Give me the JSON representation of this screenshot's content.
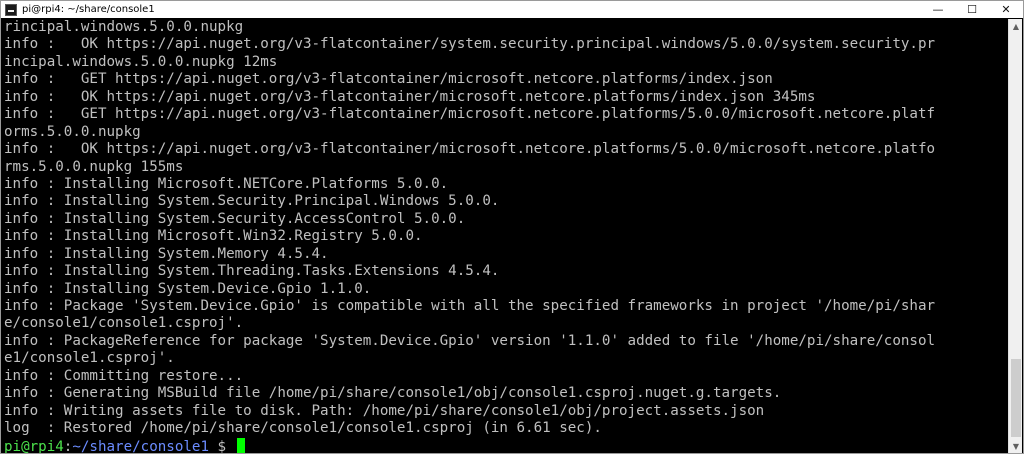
{
  "window": {
    "title": "pi@rpi4: ~/share/console1",
    "minimize": "—",
    "maximize": "☐",
    "close": "✕"
  },
  "terminal": {
    "lines": [
      "rincipal.windows.5.0.0.nupkg",
      "info :   OK https://api.nuget.org/v3-flatcontainer/system.security.principal.windows/5.0.0/system.security.pr",
      "incipal.windows.5.0.0.nupkg 12ms",
      "info :   GET https://api.nuget.org/v3-flatcontainer/microsoft.netcore.platforms/index.json",
      "info :   OK https://api.nuget.org/v3-flatcontainer/microsoft.netcore.platforms/index.json 345ms",
      "info :   GET https://api.nuget.org/v3-flatcontainer/microsoft.netcore.platforms/5.0.0/microsoft.netcore.platf",
      "orms.5.0.0.nupkg",
      "info :   OK https://api.nuget.org/v3-flatcontainer/microsoft.netcore.platforms/5.0.0/microsoft.netcore.platfo",
      "rms.5.0.0.nupkg 155ms",
      "info : Installing Microsoft.NETCore.Platforms 5.0.0.",
      "info : Installing System.Security.Principal.Windows 5.0.0.",
      "info : Installing System.Security.AccessControl 5.0.0.",
      "info : Installing Microsoft.Win32.Registry 5.0.0.",
      "info : Installing System.Memory 4.5.4.",
      "info : Installing System.Threading.Tasks.Extensions 4.5.4.",
      "info : Installing System.Device.Gpio 1.1.0.",
      "info : Package 'System.Device.Gpio' is compatible with all the specified frameworks in project '/home/pi/shar",
      "e/console1/console1.csproj'.",
      "info : PackageReference for package 'System.Device.Gpio' version '1.1.0' added to file '/home/pi/share/consol",
      "e1/console1.csproj'.",
      "info : Committing restore...",
      "info : Generating MSBuild file /home/pi/share/console1/obj/console1.csproj.nuget.g.targets.",
      "info : Writing assets file to disk. Path: /home/pi/share/console1/obj/project.assets.json",
      "log  : Restored /home/pi/share/console1/console1.csproj (in 6.61 sec)."
    ],
    "prompt": {
      "user_host": "pi@rpi4",
      "separator": ":",
      "path": "~/share/console1",
      "symbol": " $ "
    }
  },
  "colors": {
    "background": "#000000",
    "text": "#c0c0c0",
    "prompt_user": "#4ce24c",
    "prompt_path": "#6b8cff",
    "cursor": "#00ff00"
  }
}
